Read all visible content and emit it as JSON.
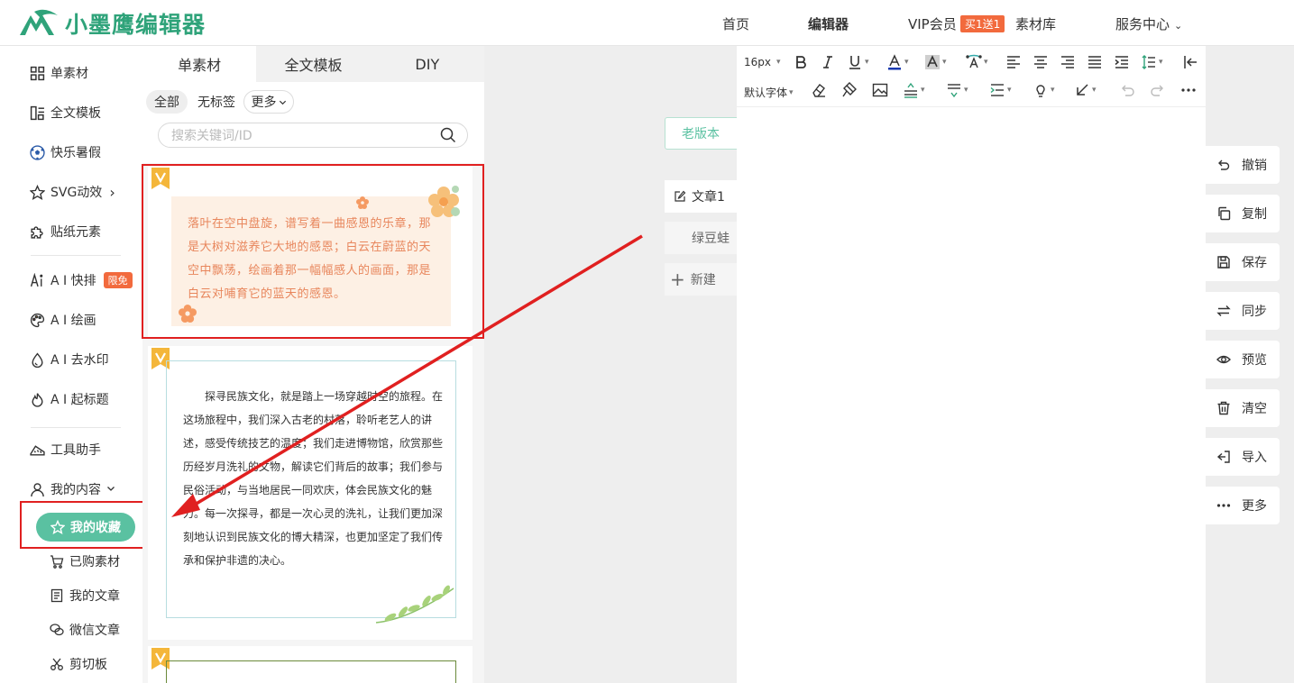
{
  "header": {
    "logo_text": "小墨鹰编辑器",
    "nav": [
      "首页",
      "编辑器",
      "VIP会员",
      "素材库",
      "服务中心"
    ],
    "vip_badge": "买1送1",
    "service_caret": "⌄"
  },
  "leftnav": {
    "items": [
      "单素材",
      "全文模板",
      "快乐暑假",
      "SVG动效",
      "贴纸元素",
      "A I 快排",
      "A I 绘画",
      "A I 去水印",
      "A I 起标题",
      "工具助手",
      "我的内容"
    ],
    "svg_arrow": "›",
    "ai_badge": "限免",
    "favorites": "我的收藏",
    "subitems": [
      "已购素材",
      "我的文章",
      "微信文章",
      "剪切板"
    ]
  },
  "materials": {
    "tabs": [
      "单素材",
      "全文模板",
      "DIY"
    ],
    "filters": [
      "全部",
      "无标签",
      "更多"
    ],
    "search_placeholder": "搜索关键词/ID",
    "card1_text": "落叶在空中盘旋，谱写着一曲感恩的乐章，那是大树对滋养它大地的感恩；白云在蔚蓝的天空中飘荡，绘画着那一幅幅感人的画面，那是白云对哺育它的蓝天的感恩。",
    "card2_text": "探寻民族文化，就是踏上一场穿越时空的旅程。在这场旅程中，我们深入古老的村落，聆听老艺人的讲述，感受传统技艺的温度；我们走进博物馆，欣赏那些历经岁月洗礼的文物，解读它们背后的故事；我们参与民俗活动，与当地居民一同欢庆，体会民族文化的魅力。每一次探寻，都是一次心灵的洗礼，让我们更加深刻地认识到民族文化的博大精深，也更加坚定了我们传承和保护非遗的决心。"
  },
  "middle": {
    "old_version": "老版本",
    "docs": [
      "文章1",
      "绿豆蛙"
    ],
    "new": "新建"
  },
  "editor": {
    "font_size": "16px",
    "font_family": "默认字体"
  },
  "actions": [
    "撤销",
    "复制",
    "保存",
    "同步",
    "预览",
    "清空",
    "导入",
    "更多"
  ],
  "colors": {
    "brand": "#2fa37a",
    "accent": "#5ac1a1",
    "badge": "#f26a3d",
    "highlight": "#e02020"
  }
}
